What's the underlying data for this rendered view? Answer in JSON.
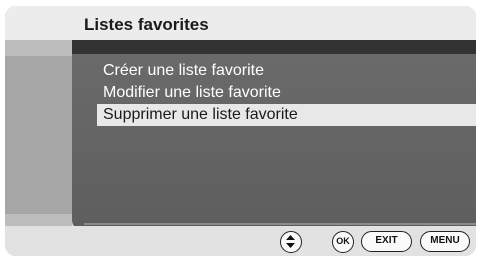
{
  "header": {
    "title": "Listes favorites"
  },
  "menu": {
    "items": [
      {
        "label": "Créer une liste favorite",
        "selected": false
      },
      {
        "label": "Modifier une liste favorite",
        "selected": false
      },
      {
        "label": "Supprimer une liste favorite",
        "selected": true
      }
    ]
  },
  "footer": {
    "navigate_icon": "up-down-arrows-icon",
    "ok_label": "OK",
    "exit_label": "EXIT",
    "menu_label": "MENU"
  },
  "colors": {
    "panel": "#636363",
    "selection": "#e8e8e8",
    "title_bar": "#ececec"
  }
}
